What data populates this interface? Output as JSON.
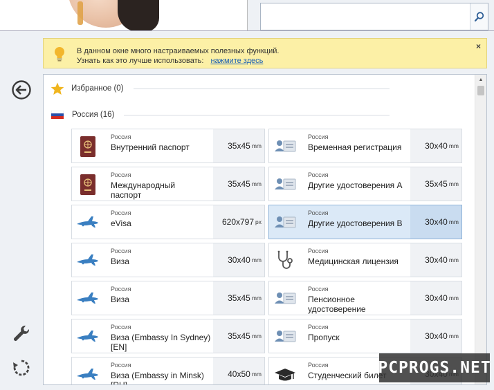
{
  "search": {
    "value": "",
    "placeholder": ""
  },
  "info": {
    "line1": "В данном окне много настраиваемых полезных функций.",
    "line2": "Узнать как это лучше использовать:",
    "link": "нажмите здесь",
    "close": "×"
  },
  "groups": {
    "favorites": "Избранное (0)",
    "russia": "Россия (16)"
  },
  "cards": [
    {
      "country": "Россия",
      "title": "Внутренний паспорт",
      "size": "35x45",
      "unit": "mm",
      "icon": "passport-icon"
    },
    {
      "country": "Россия",
      "title": "Временная регистрация",
      "size": "30x40",
      "unit": "mm",
      "icon": "id-card-icon"
    },
    {
      "country": "Россия",
      "title": "Международный паспорт",
      "size": "35x45",
      "unit": "mm",
      "icon": "passport-icon"
    },
    {
      "country": "Россия",
      "title": "Другие удостоверения A",
      "size": "35x45",
      "unit": "mm",
      "icon": "id-card-icon"
    },
    {
      "country": "Россия",
      "title": "eVisa",
      "size": "620x797",
      "unit": "px",
      "icon": "airplane-icon"
    },
    {
      "country": "Россия",
      "title": "Другие удостоверения B",
      "size": "30x40",
      "unit": "mm",
      "icon": "id-card-icon"
    },
    {
      "country": "Россия",
      "title": "Виза",
      "size": "30x40",
      "unit": "mm",
      "icon": "airplane-icon"
    },
    {
      "country": "Россия",
      "title": "Медицинская лицензия",
      "size": "30x40",
      "unit": "mm",
      "icon": "stethoscope-icon"
    },
    {
      "country": "Россия",
      "title": "Виза",
      "size": "35x45",
      "unit": "mm",
      "icon": "airplane-icon"
    },
    {
      "country": "Россия",
      "title": "Пенсионное удостоверение",
      "size": "30x40",
      "unit": "mm",
      "icon": "id-card-icon"
    },
    {
      "country": "Россия",
      "title": "Виза (Embassy In Sydney) [EN]",
      "size": "35x45",
      "unit": "mm",
      "icon": "airplane-icon"
    },
    {
      "country": "Россия",
      "title": "Пропуск",
      "size": "30x40",
      "unit": "mm",
      "icon": "id-card-icon"
    },
    {
      "country": "Россия",
      "title": "Виза (Embassy in Minsk) [RU]",
      "size": "40x50",
      "unit": "mm",
      "icon": "airplane-icon"
    },
    {
      "country": "Россия",
      "title": "Студенческий билет",
      "size": "30x40",
      "unit": "mm",
      "icon": "graduation-cap-icon"
    }
  ],
  "watermark": "PCPROGS.NET",
  "colors": {
    "info_bg": "#fcf0a6",
    "selected_bg": "#dbe9f7",
    "accent": "#1a5fb4",
    "icon_blue": "#3a7fc1"
  }
}
